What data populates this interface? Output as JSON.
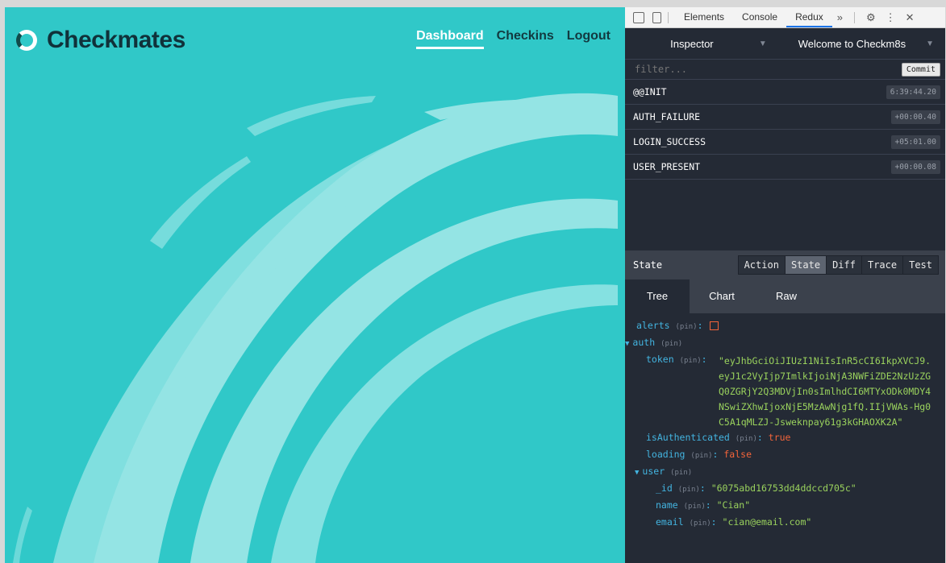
{
  "app": {
    "brand": "Checkmates",
    "nav": [
      {
        "label": "Dashboard",
        "active": true
      },
      {
        "label": "Checkins",
        "active": false
      },
      {
        "label": "Logout",
        "active": false
      }
    ],
    "colors": {
      "background": "#30c8c8",
      "brush": "#9ae6e6",
      "brand_text": "#10323a",
      "active_nav": "#ffffff"
    }
  },
  "devtools": {
    "tabs": [
      "Elements",
      "Console",
      "Redux"
    ],
    "active_tab": "Redux",
    "more_icon": "double-chevron-icon",
    "settings_icon": "gear-icon",
    "menu_icon": "kebab-icon",
    "close_icon": "close-icon",
    "monitor": "Inspector",
    "instance": "Welcome to Checkm8s",
    "filter_placeholder": "filter...",
    "commit_label": "Commit",
    "actions": [
      {
        "type": "@@INIT",
        "time": "6:39:44.20"
      },
      {
        "type": "AUTH_FAILURE",
        "time": "+00:00.40"
      },
      {
        "type": "LOGIN_SUCCESS",
        "time": "+05:01.00"
      },
      {
        "type": "USER_PRESENT",
        "time": "+00:00.08"
      }
    ],
    "state_label": "State",
    "view_buttons": [
      "Action",
      "State",
      "Diff",
      "Trace",
      "Test"
    ],
    "active_view": "State",
    "sub_tabs": [
      "Tree",
      "Chart",
      "Raw"
    ],
    "active_sub_tab": "Tree",
    "pin": "(pin)",
    "tree": {
      "alerts_key": "alerts",
      "auth_key": "auth",
      "token_key": "token",
      "token_value": "\"eyJhbGciOiJIUzI1NiIsInR5cCI6IkpXVCJ9.eyJ1c2VyIjp7ImlkIjoiNjA3NWFiZDE2NzUzZGQ0ZGRjY2Q3MDVjIn0sImlhdCI6MTYxODk0MDY4NSwiZXhwIjoxNjE5MzAwNjg1fQ.IIjVWAs-Hg0C5A1qMLZJ-Jsweknpay61g3kGHAOXK2A\"",
      "isAuthenticated_key": "isAuthenticated",
      "isAuthenticated_value": "true",
      "loading_key": "loading",
      "loading_value": "false",
      "user_key": "user",
      "id_key": "_id",
      "id_value": "\"6075abd16753dd4ddccd705c\"",
      "name_key": "name",
      "name_value": "\"Cian\"",
      "email_key": "email",
      "email_value": "\"cian@email.com\""
    },
    "colors": {
      "panel": "#242a35",
      "key": "#43b4e0",
      "string": "#9ad25d",
      "boolean": "#f3643a"
    }
  }
}
